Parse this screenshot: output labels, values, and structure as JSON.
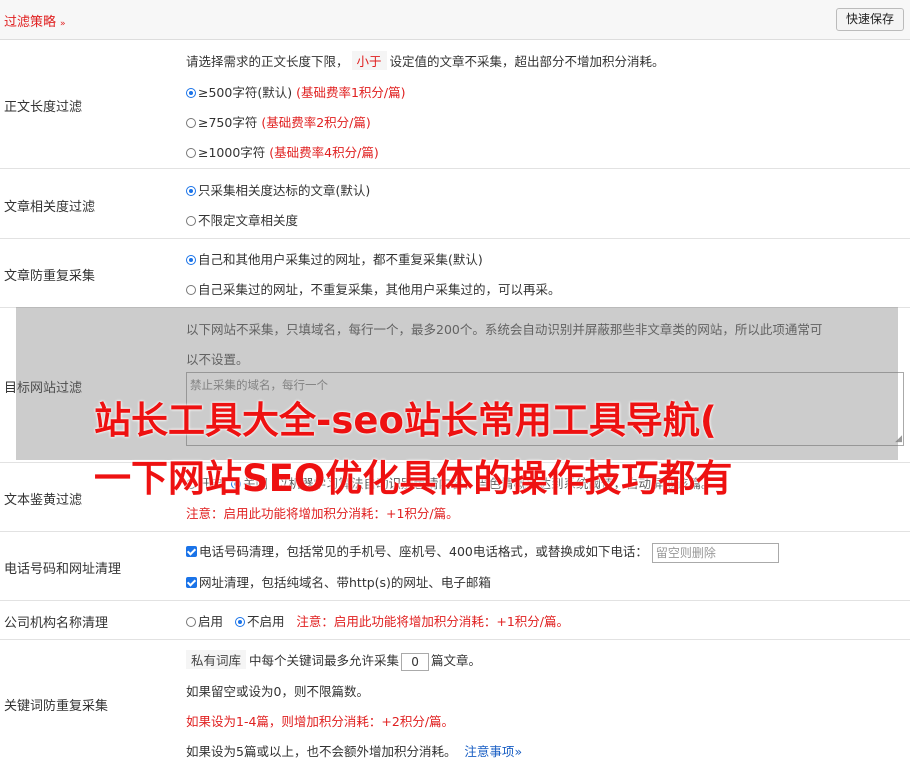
{
  "header": {
    "title": "过滤策略",
    "save_label": "快速保存"
  },
  "length_filter": {
    "label": "正文长度过滤",
    "desc_before": "请选择需求的正文长度下限，",
    "desc_tag": "小于",
    "desc_after": "设定值的文章不采集，超出部分不增加积分消耗。",
    "options": [
      {
        "text": "≥500字符(默认)",
        "note": "(基础费率1积分/篇)",
        "selected": true
      },
      {
        "text": "≥750字符",
        "note": "(基础费率2积分/篇)",
        "selected": false
      },
      {
        "text": "≥1000字符",
        "note": "(基础费率4积分/篇)",
        "selected": false
      }
    ]
  },
  "relevance": {
    "label": "文章相关度过滤",
    "options": [
      {
        "text": "只采集相关度达标的文章(默认)",
        "selected": true
      },
      {
        "text": "不限定文章相关度",
        "selected": false
      }
    ]
  },
  "dedupe": {
    "label": "文章防重复采集",
    "options": [
      {
        "text": "自己和其他用户采集过的网址，都不重复采集(默认)",
        "selected": true
      },
      {
        "text": "自己采集过的网址，不重复采集，其他用户采集过的，可以再采。",
        "selected": false
      }
    ]
  },
  "site_filter": {
    "label": "目标网站过滤",
    "desc_line1": "以下网站不采集，只填域名，每行一个，最多200个。系统会自动识别并屏蔽那些非文章类的网站，所以此项通常可",
    "desc_line2": "以不设置。",
    "placeholder": "禁止采集的域名，每行一个"
  },
  "porn_filter": {
    "label": "文本鉴黄过滤",
    "opt_on": "开启",
    "opt_off": "关闭",
    "desc": "以机器学习算法自动识别色情内容，当色情概率达到系统阈值，自动屏蔽该篇。",
    "note": "注意：启用此功能将增加积分消耗：+1积分/篇。"
  },
  "phone_url": {
    "label": "电话号码和网址清理",
    "phone_text": "电话号码清理，包括常见的手机号、座机号、400电话格式，或替换成如下电话：",
    "phone_placeholder": "留空则删除",
    "url_text": "网址清理，包括纯域名、带http(s)的网址、电子邮箱"
  },
  "company": {
    "label": "公司机构名称清理",
    "opt_on": "启用",
    "opt_off": "不启用",
    "note": "注意：启用此功能将增加积分消耗：+1积分/篇。"
  },
  "keyword": {
    "label": "关键词防重复采集",
    "tag": "私有词库",
    "line1_a": "中每个关键词最多允许采集",
    "count": "0",
    "line1_b": "篇文章。",
    "line2": "如果留空或设为0，则不限篇数。",
    "line3": "如果设为1-4篇，则增加积分消耗：+2积分/篇。",
    "line4": "如果设为5篇或以上，也不会额外增加积分消耗。",
    "link": "注意事项"
  },
  "watermark": {
    "line1": "站长工具大全-seo站长常用工具导航(",
    "line2": "一下网站SEO优化具体的操作技巧都有"
  }
}
